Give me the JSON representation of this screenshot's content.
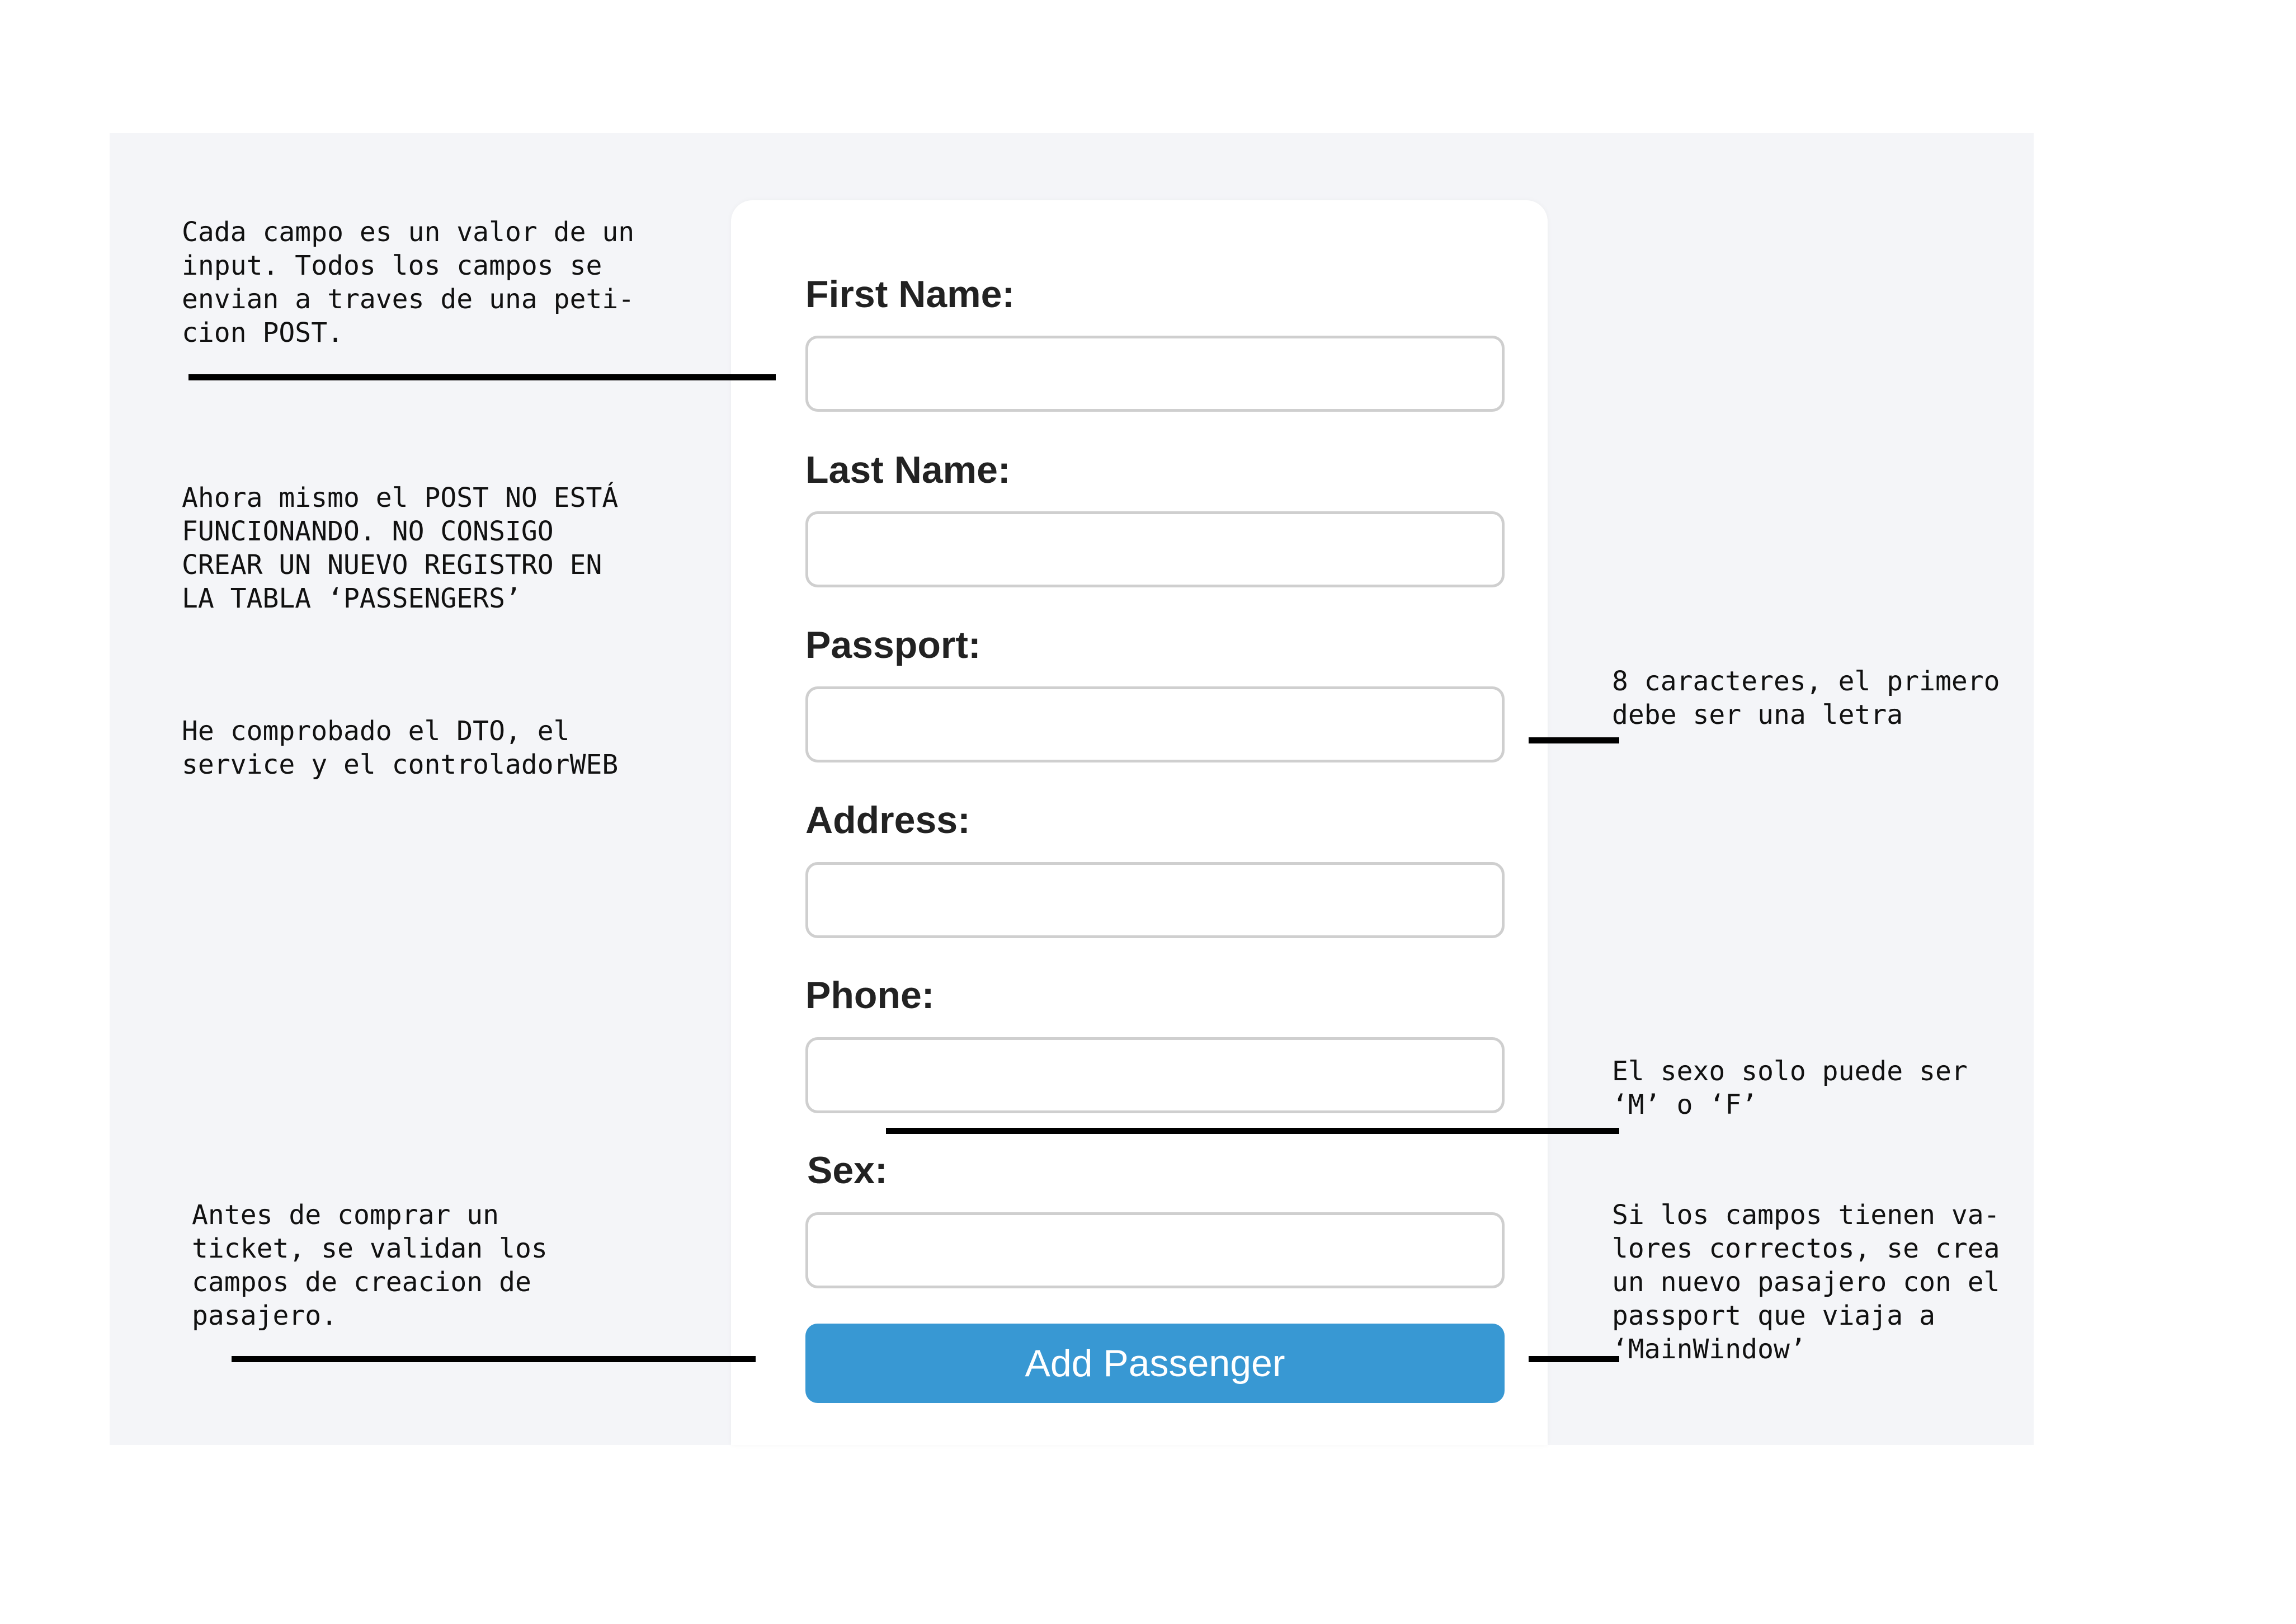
{
  "form": {
    "fields": [
      {
        "label": "First Name:",
        "value": "",
        "placeholder": ""
      },
      {
        "label": "Last Name:",
        "value": "",
        "placeholder": ""
      },
      {
        "label": "Passport:",
        "value": "",
        "placeholder": ""
      },
      {
        "label": "Address:",
        "value": "",
        "placeholder": ""
      },
      {
        "label": "Phone:",
        "value": "",
        "placeholder": ""
      },
      {
        "label": "Sex:",
        "value": "",
        "placeholder": ""
      }
    ],
    "submit_label": "Add Passenger",
    "submit_color": "#3898d3"
  },
  "notes": {
    "fields_post": "Cada campo es un valor de un\ninput. Todos los campos se\nenvian a traves de una peti-\ncion POST.",
    "post_not_working": "Ahora mismo el POST NO ESTÁ\nFUNCIONANDO. NO CONSIGO\nCREAR UN NUEVO REGISTRO EN\nLA TABLA ‘PASSENGERS’",
    "checked": "He comprobado el DTO, el\nservice y el controladorWEB",
    "validation": "Antes de comprar un\nticket, se validan los\ncampos de creacion de\npasajero.",
    "passport_rule": "8 caracteres, el primero\ndebe ser una letra",
    "sex_rule": "El sexo solo puede ser\n‘M’ o ‘F’",
    "result": "Si los campos tienen va-\nlores correctos, se crea\nun nuevo pasajero con el\npassport que viaja a\n‘MainWindow’"
  }
}
